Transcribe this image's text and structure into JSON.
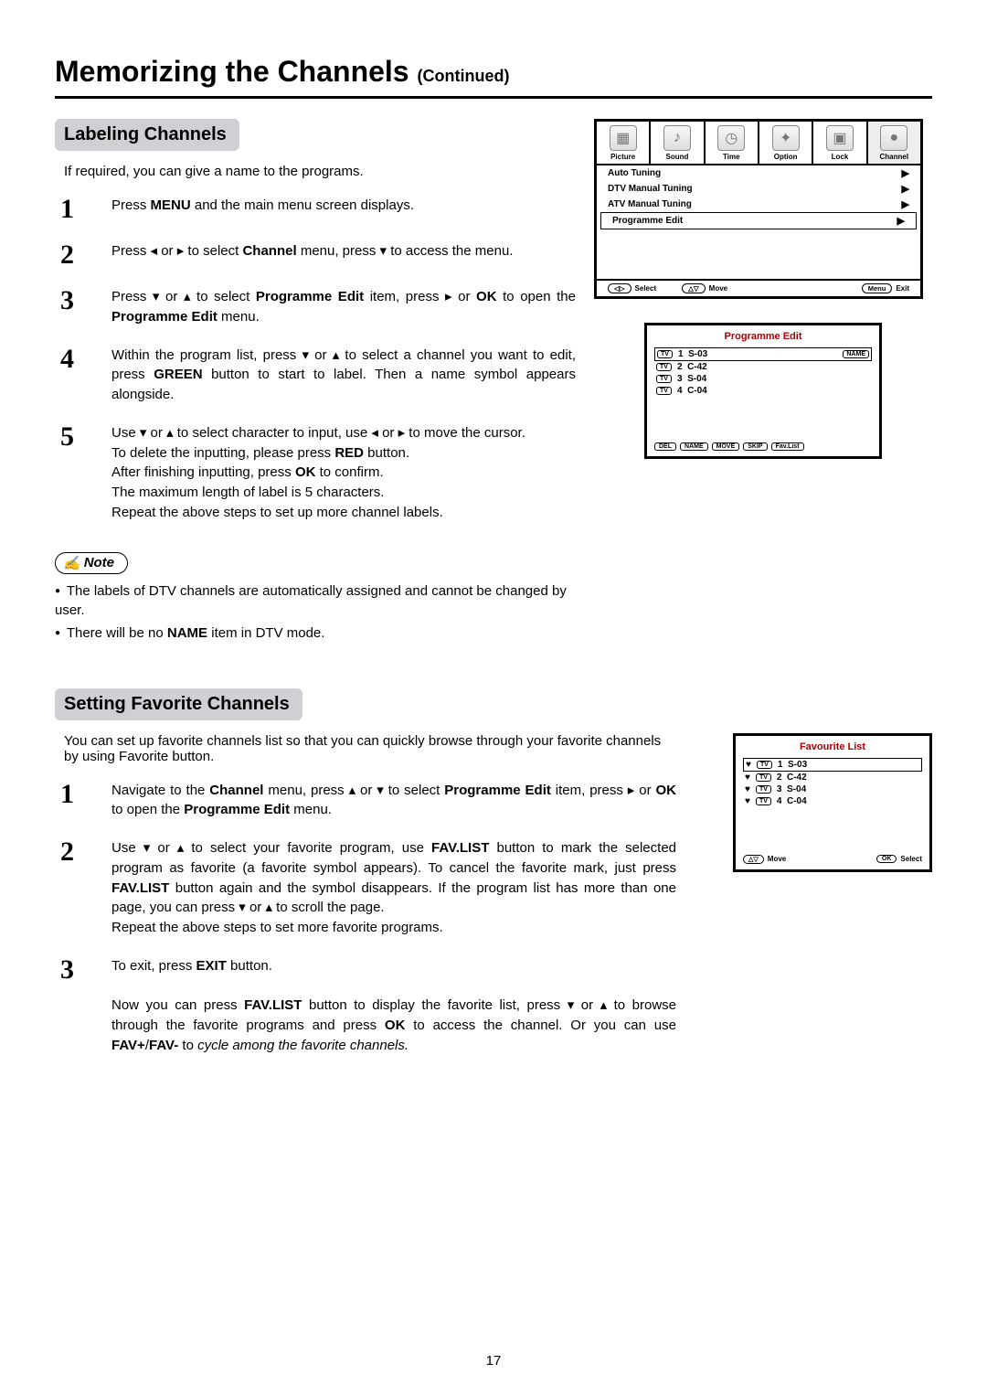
{
  "page_number": "17",
  "title_main": "Memorizing the Channels",
  "title_cont": "(Continued)",
  "section_labeling": {
    "heading": "Labeling Channels",
    "intro": "If required, you can give a name to the programs.",
    "steps": [
      {
        "num": "1",
        "html": "Press <b>MENU</b> and the main menu screen displays."
      },
      {
        "num": "2",
        "html": "Press <span class='tri-l'></span> or <span class='tri-r'></span> to select <b>Channel</b> menu,  press <span class='tri-d'></span> to access the menu."
      },
      {
        "num": "3",
        "html": "Press <span class='tri-d'></span> or <span class='tri-u'></span> to select <b>Programme Edit</b> item, press <span class='tri-r'></span> or <b>OK</b> to open the <b>Programme Edit</b> menu."
      },
      {
        "num": "4",
        "html": "Within the program list,  press <span class='tri-d'></span> or <span class='tri-u'></span> to select a channel you want to edit, press <b>GREEN</b> button to start to label. Then a name symbol appears alongside."
      },
      {
        "num": "5",
        "html": "Use <span class='tri-d'></span> or <span class='tri-u'></span> to select character to input, use <span class='tri-l'></span> or <span class='tri-r'></span> to move the cursor.<br>To delete the inputting, please press <b>RED</b> button.<br>After finishing inputting, press <b>OK</b> to confirm.<br>The maximum length of label is 5 characters.<br>Repeat the above steps to set up more channel labels."
      }
    ],
    "note_label": "Note",
    "notes": [
      "The labels of DTV channels are automatically assigned and cannot be changed by user.",
      "There will be no <b>NAME</b> item in DTV mode."
    ]
  },
  "section_favorite": {
    "heading": "Setting Favorite Channels",
    "intro": "You can set up favorite channels list so that you can quickly browse through your favorite channels by using Favorite button.",
    "steps": [
      {
        "num": "1",
        "html": "Navigate to the <b>Channel</b> menu,  press <span class='tri-u'></span> or <span class='tri-d'></span> to select <b>Programme Edit</b> item, press <span class='tri-r'></span> or <b>OK</b> to open the <b>Programme Edit</b> menu."
      },
      {
        "num": "2",
        "html": "Use <span class='tri-d'></span> or <span class='tri-u'></span> to select your favorite program, use <b>FAV.LIST</b> button to mark the selected program as favorite (a favorite symbol appears).  To cancel the favorite mark, just press <b>FAV.LIST</b> button again and the symbol disappears. If the program list has more than one page, you can press <span class='tri-d'></span> or <span class='tri-u'></span> to scroll the page.<br>Repeat the above steps to set more favorite programs."
      },
      {
        "num": "3",
        "html": "To exit, press <b>EXIT</b> button.<br><br>Now you can press <b>FAV.LIST</b> button to display the favorite list, press <span class='tri-d'></span> or <span class='tri-u'></span> to browse through the favorite programs and press <b>OK</b> to access the channel. Or you can use <b>FAV+</b>/<b>FAV-</b> to <i>cycle among the favorite channels.</i>"
      }
    ]
  },
  "osd_main": {
    "tabs": [
      "Picture",
      "Sound",
      "Time",
      "Option",
      "Lock",
      "Channel"
    ],
    "tab_icons": [
      "▦",
      "♪",
      "◷",
      "✦",
      "▣",
      "●"
    ],
    "rows": [
      {
        "label": "Auto Tuning",
        "selected": false
      },
      {
        "label": "DTV Manual Tuning",
        "selected": false
      },
      {
        "label": "ATV Manual Tuning",
        "selected": false
      },
      {
        "label": "Programme Edit",
        "selected": true
      }
    ],
    "footer": {
      "select_key": "◁▷",
      "select_lbl": "Select",
      "move_key": "△▽",
      "move_lbl": "Move",
      "menu_key": "Menu",
      "menu_lbl": "Exit"
    }
  },
  "osd_progedit": {
    "title": "Programme Edit",
    "rows": [
      {
        "n": "1",
        "ch": "S-03",
        "selected": true,
        "name_badge": "NAME"
      },
      {
        "n": "2",
        "ch": "C-42"
      },
      {
        "n": "3",
        "ch": "S-04"
      },
      {
        "n": "4",
        "ch": "C-04"
      }
    ],
    "footer_btns": [
      "DEL",
      "NAME",
      "MOVE",
      "SKIP",
      "Fav.List"
    ]
  },
  "osd_favlist": {
    "title": "Favourite List",
    "rows": [
      {
        "n": "1",
        "ch": "S-03",
        "selected": true
      },
      {
        "n": "2",
        "ch": "C-42"
      },
      {
        "n": "3",
        "ch": "S-04"
      },
      {
        "n": "4",
        "ch": "C-04"
      }
    ],
    "footer": {
      "move_key": "△▽",
      "move_lbl": "Move",
      "ok_key": "OK",
      "ok_lbl": "Select"
    }
  }
}
